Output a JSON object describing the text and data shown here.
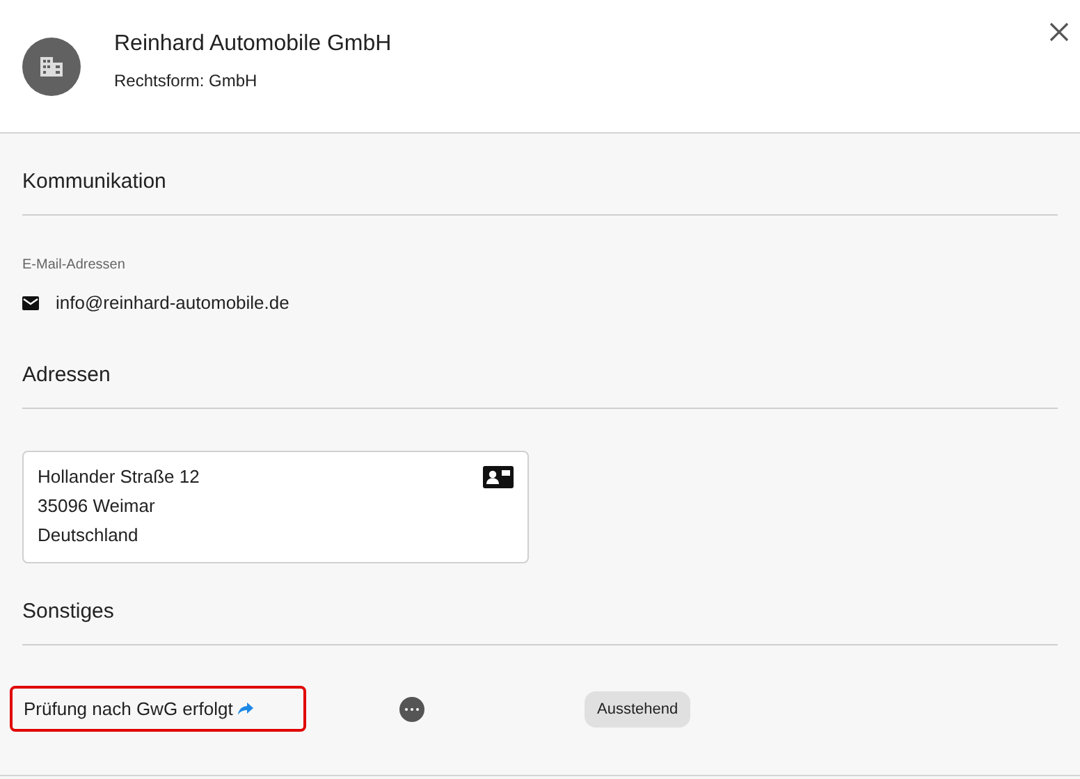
{
  "header": {
    "title": "Reinhard Automobile GmbH",
    "subtitle": "Rechtsform: GmbH"
  },
  "sections": [
    {
      "kind": "contact",
      "title": "Kommunikation",
      "label": "E-Mail-Adressen",
      "email": "info@reinhard-automobile.de"
    },
    {
      "kind": "address",
      "title": "Adressen",
      "lines": [
        "Hollander Straße 12",
        "35096 Weimar",
        "Deutschland"
      ]
    },
    {
      "kind": "other",
      "title": "Sonstiges",
      "check": {
        "label": "Prüfung nach GwG erfolgt",
        "highlighted": true,
        "status": "Ausstehend"
      }
    }
  ]
}
